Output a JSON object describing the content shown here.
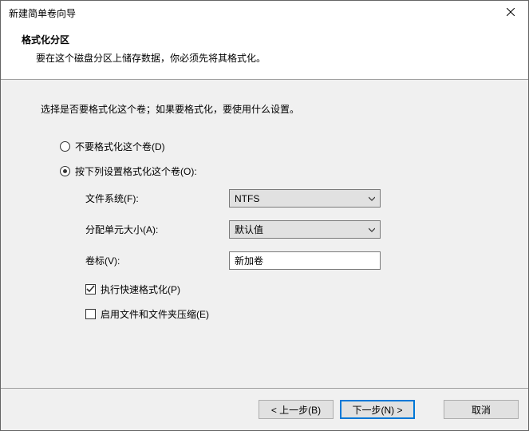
{
  "window": {
    "title": "新建简单卷向导"
  },
  "header": {
    "heading": "格式化分区",
    "subheading": "要在这个磁盘分区上储存数据，你必须先将其格式化。"
  },
  "content": {
    "instruction": "选择是否要格式化这个卷；如果要格式化，要使用什么设置。",
    "radio_noformat": "不要格式化这个卷(D)",
    "radio_format": "按下列设置格式化这个卷(O):",
    "fs_label": "文件系统(F):",
    "fs_value": "NTFS",
    "au_label": "分配单元大小(A):",
    "au_value": "默认值",
    "vol_label": "卷标(V):",
    "vol_value": "新加卷",
    "quickformat_label": "执行快速格式化(P)",
    "compression_label": "启用文件和文件夹压缩(E)"
  },
  "footer": {
    "back": "< 上一步(B)",
    "next": "下一步(N) >",
    "cancel": "取消"
  }
}
